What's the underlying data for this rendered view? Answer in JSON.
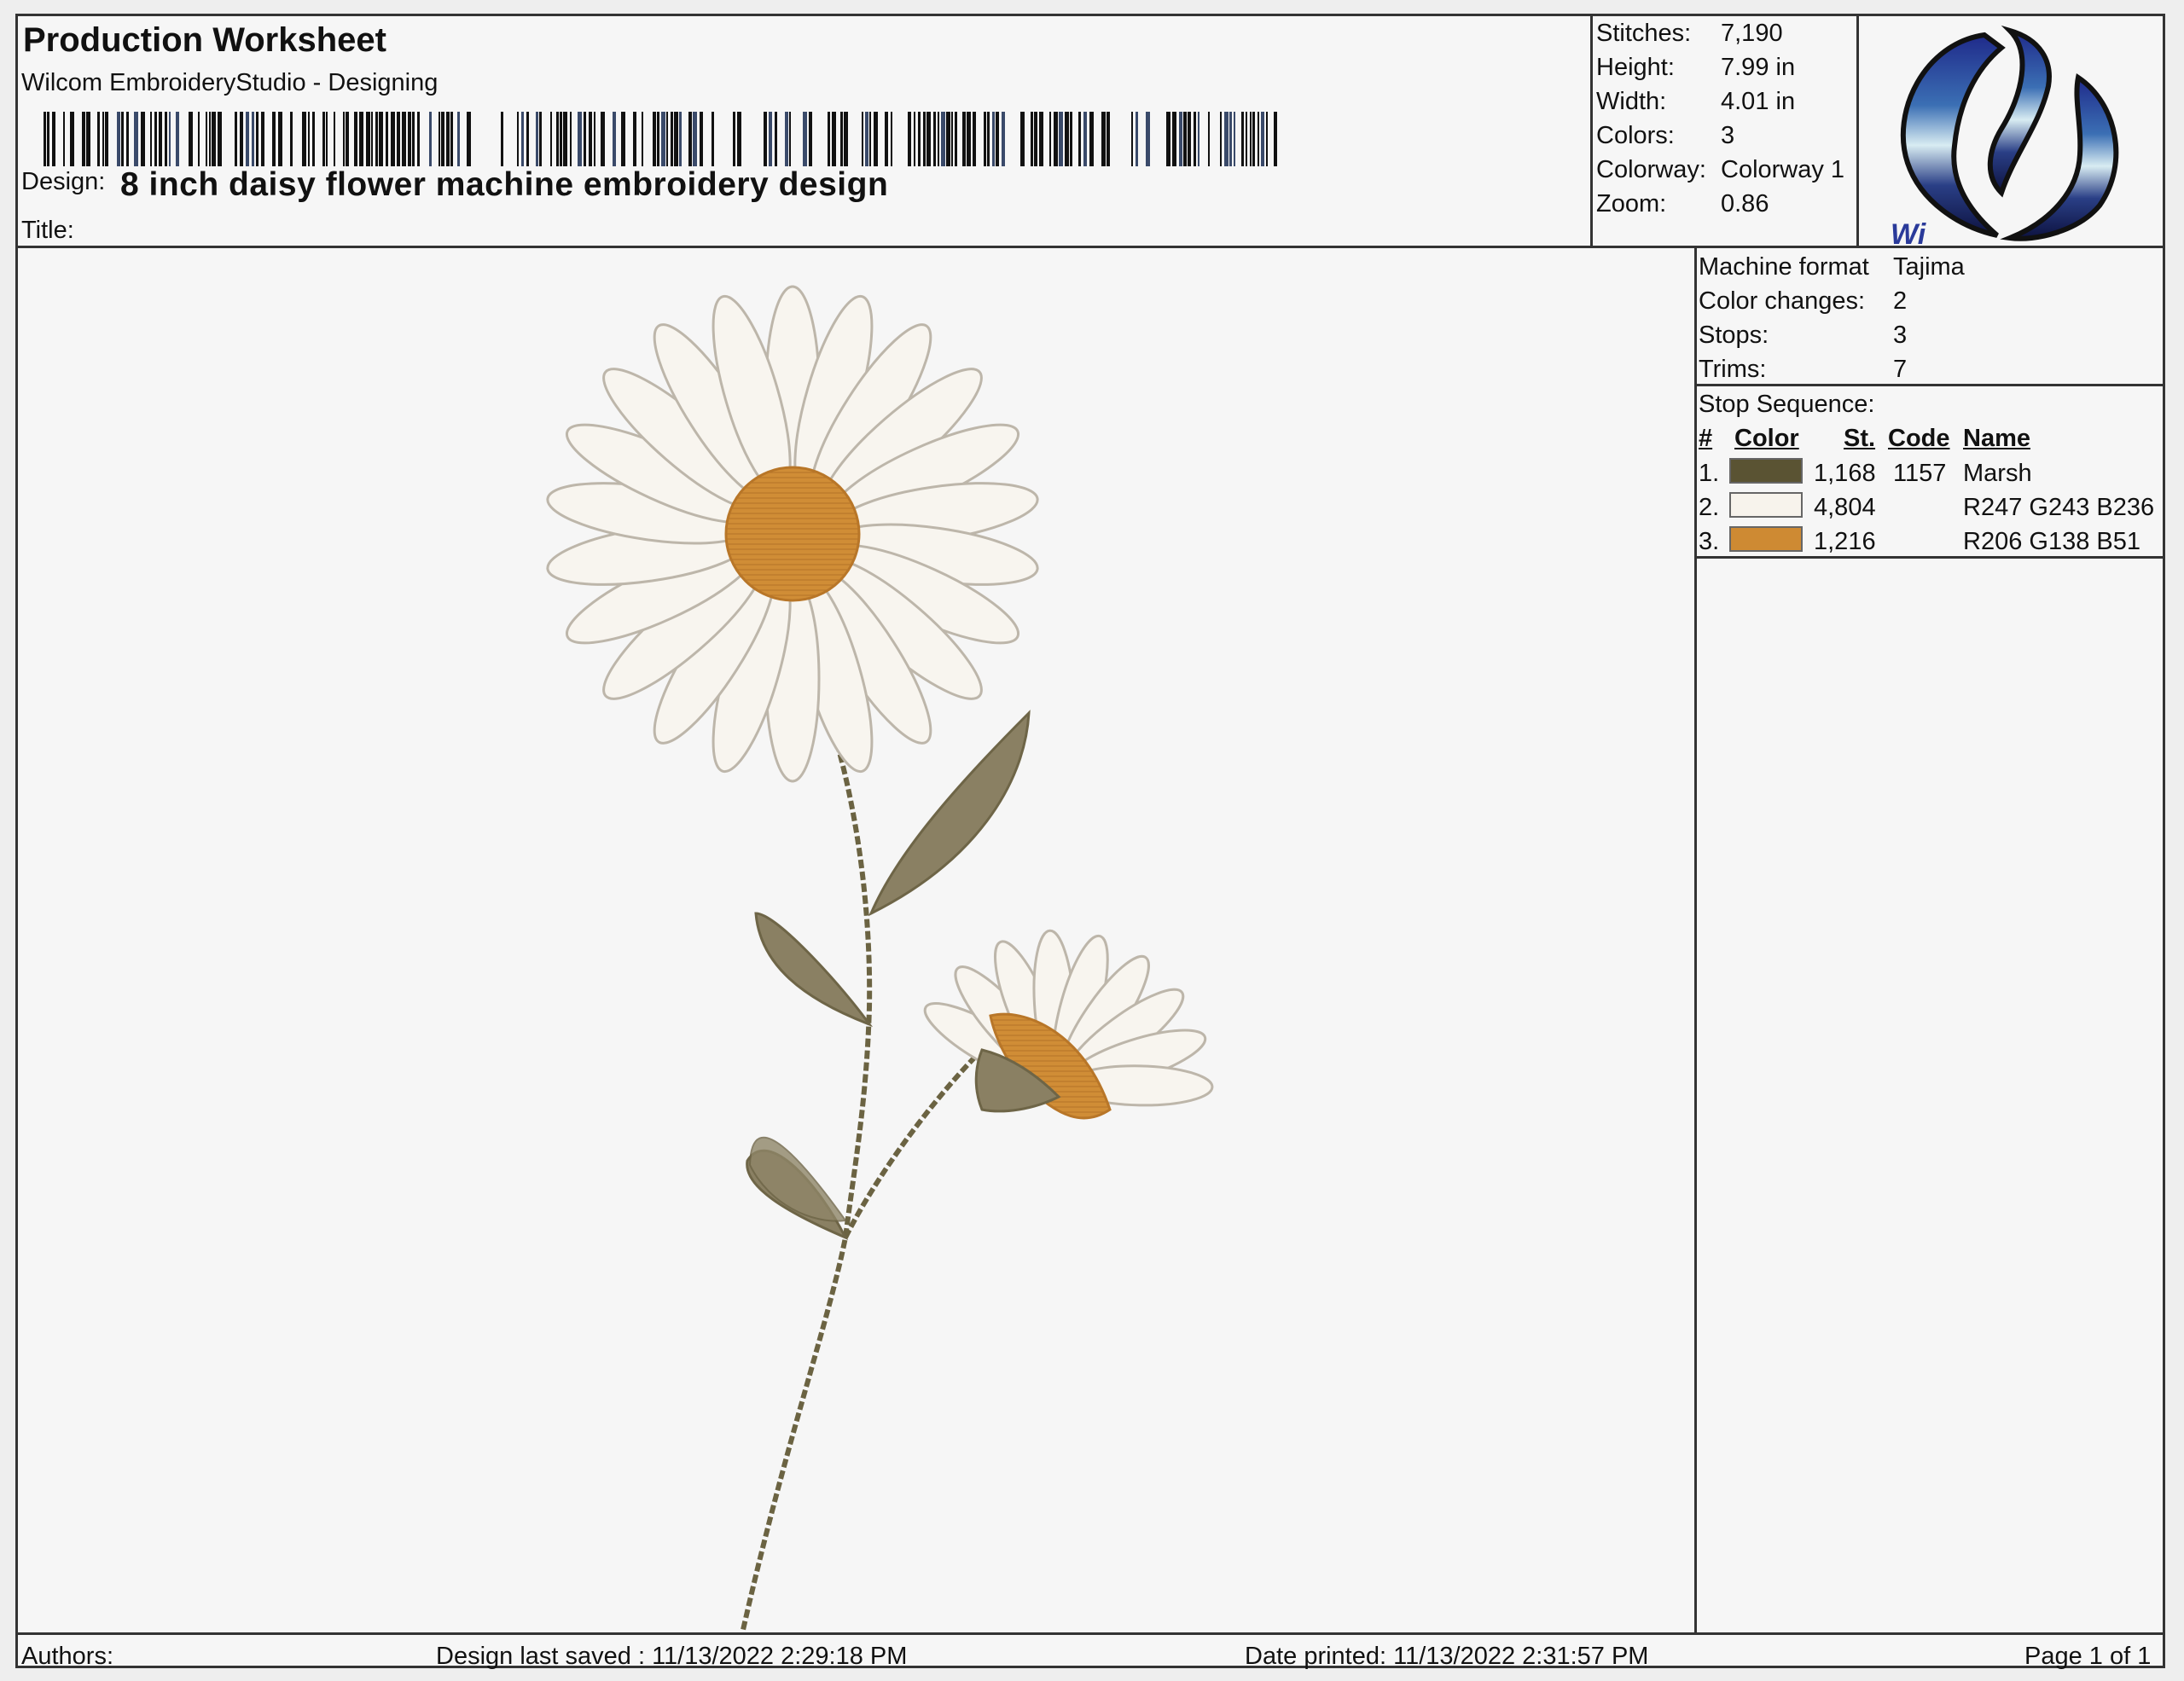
{
  "header": {
    "title": "Production Worksheet",
    "software": "Wilcom EmbroideryStudio - Designing",
    "design_label": "Design:",
    "design_name": "8 inch daisy flower machine embroidery design",
    "title_label": "Title:",
    "title_value": ""
  },
  "stats": [
    {
      "label": "Stitches:",
      "value": "7,190"
    },
    {
      "label": "Height:",
      "value": "7.99 in"
    },
    {
      "label": "Width:",
      "value": "4.01 in"
    },
    {
      "label": "Colors:",
      "value": "3"
    },
    {
      "label": "Colorway:",
      "value": "Colorway 1"
    },
    {
      "label": "Zoom:",
      "value": "0.86"
    }
  ],
  "machine": [
    {
      "label": "Machine format",
      "value": "Tajima"
    },
    {
      "label": "Color changes:",
      "value": "2"
    },
    {
      "label": "Stops:",
      "value": "3"
    },
    {
      "label": "Trims:",
      "value": "7"
    }
  ],
  "stop_sequence": {
    "label": "Stop Sequence:",
    "headers": {
      "num": "#",
      "color": "Color",
      "st": "St.",
      "code": "Code",
      "name": "Name"
    },
    "rows": [
      {
        "num": "1.",
        "color": "#5a5333",
        "st": "1,168",
        "code": "1157",
        "name": "Marsh"
      },
      {
        "num": "2.",
        "color": "#f7f3ec",
        "st": "4,804",
        "code": "",
        "name": "R247 G243 B236"
      },
      {
        "num": "3.",
        "color": "#ce8a33",
        "st": "1,216",
        "code": "",
        "name": "R206 G138 B51"
      }
    ]
  },
  "footer": {
    "authors": "Authors:",
    "last_saved": "Design last saved : 11/13/2022 2:29:18 PM",
    "date_printed": "Date printed: 11/13/2022 2:31:57 PM",
    "page": "Page 1 of 1"
  },
  "logo": {
    "partial_text": "Wi"
  },
  "colors": {
    "leaf": "#8a8063",
    "stem": "#6b6342",
    "petal": "#f7f3ec",
    "center": "#ce8a33"
  }
}
